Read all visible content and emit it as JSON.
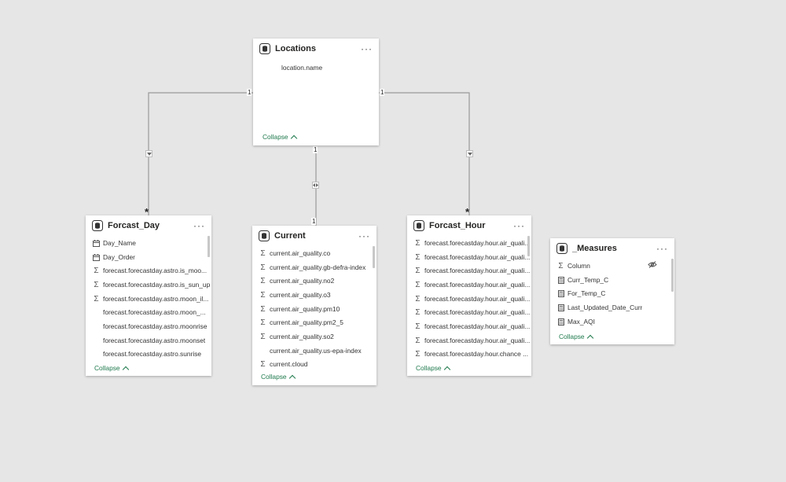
{
  "tables": {
    "locations": {
      "title": "Locations",
      "fields": [
        {
          "label": "location.name",
          "icon": "none"
        }
      ],
      "collapse_label": "Collapse"
    },
    "forcast_day": {
      "title": "Forcast_Day",
      "fields": [
        {
          "label": "Day_Name",
          "icon": "calendar-column-icon"
        },
        {
          "label": "Day_Order",
          "icon": "calendar-column-icon"
        },
        {
          "label": "forecast.forecastday.astro.is_moo...",
          "icon": "sigma-icon"
        },
        {
          "label": "forecast.forecastday.astro.is_sun_up",
          "icon": "sigma-icon"
        },
        {
          "label": "forecast.forecastday.astro.moon_il...",
          "icon": "sigma-icon"
        },
        {
          "label": "forecast.forecastday.astro.moon_...",
          "icon": "none"
        },
        {
          "label": "forecast.forecastday.astro.moonrise",
          "icon": "none"
        },
        {
          "label": "forecast.forecastday.astro.moonset",
          "icon": "none"
        },
        {
          "label": "forecast.forecastday.astro.sunrise",
          "icon": "none"
        }
      ],
      "collapse_label": "Collapse"
    },
    "current": {
      "title": "Current",
      "fields": [
        {
          "label": "current.air_quality.co",
          "icon": "sigma-icon"
        },
        {
          "label": "current.air_quality.gb-defra-index",
          "icon": "sigma-icon"
        },
        {
          "label": "current.air_quality.no2",
          "icon": "sigma-icon"
        },
        {
          "label": "current.air_quality.o3",
          "icon": "sigma-icon"
        },
        {
          "label": "current.air_quality.pm10",
          "icon": "sigma-icon"
        },
        {
          "label": "current.air_quality.pm2_5",
          "icon": "sigma-icon"
        },
        {
          "label": "current.air_quality.so2",
          "icon": "sigma-icon"
        },
        {
          "label": "current.air_quality.us-epa-index",
          "icon": "none"
        },
        {
          "label": "current.cloud",
          "icon": "sigma-icon"
        }
      ],
      "collapse_label": "Collapse"
    },
    "forcast_hour": {
      "title": "Forcast_Hour",
      "fields": [
        {
          "label": "forecast.forecastday.hour.air_quali...",
          "icon": "sigma-icon"
        },
        {
          "label": "forecast.forecastday.hour.air_quali...",
          "icon": "sigma-icon"
        },
        {
          "label": "forecast.forecastday.hour.air_quali...",
          "icon": "sigma-icon"
        },
        {
          "label": "forecast.forecastday.hour.air_quali...",
          "icon": "sigma-icon"
        },
        {
          "label": "forecast.forecastday.hour.air_quali...",
          "icon": "sigma-icon"
        },
        {
          "label": "forecast.forecastday.hour.air_quali...",
          "icon": "sigma-icon"
        },
        {
          "label": "forecast.forecastday.hour.air_quali...",
          "icon": "sigma-icon"
        },
        {
          "label": "forecast.forecastday.hour.air_quali...",
          "icon": "sigma-icon"
        },
        {
          "label": "forecast.forecastday.hour.chance ...",
          "icon": "sigma-icon"
        }
      ],
      "collapse_label": "Collapse"
    },
    "measures": {
      "title": "_Measures",
      "fields": [
        {
          "label": "Column",
          "icon": "sigma-icon",
          "hidden": true
        },
        {
          "label": "Curr_Temp_C",
          "icon": "calculator-icon"
        },
        {
          "label": "For_Temp_C",
          "icon": "calculator-icon"
        },
        {
          "label": "Last_Updated_Date_Curr",
          "icon": "calculator-icon"
        },
        {
          "label": "Max_AQI",
          "icon": "calculator-icon"
        }
      ],
      "collapse_label": "Collapse"
    }
  },
  "relationships": {
    "loc_left_one": "1",
    "loc_right_one": "1",
    "loc_bottom_one": "1",
    "current_one": "1",
    "forcast_day_many": "*",
    "forcast_hour_many": "*"
  },
  "more_glyph": "···",
  "colors": {
    "canvas": "#e6e6e6",
    "collapse_link": "#1f7a4d",
    "line": "#9a9a9a"
  }
}
